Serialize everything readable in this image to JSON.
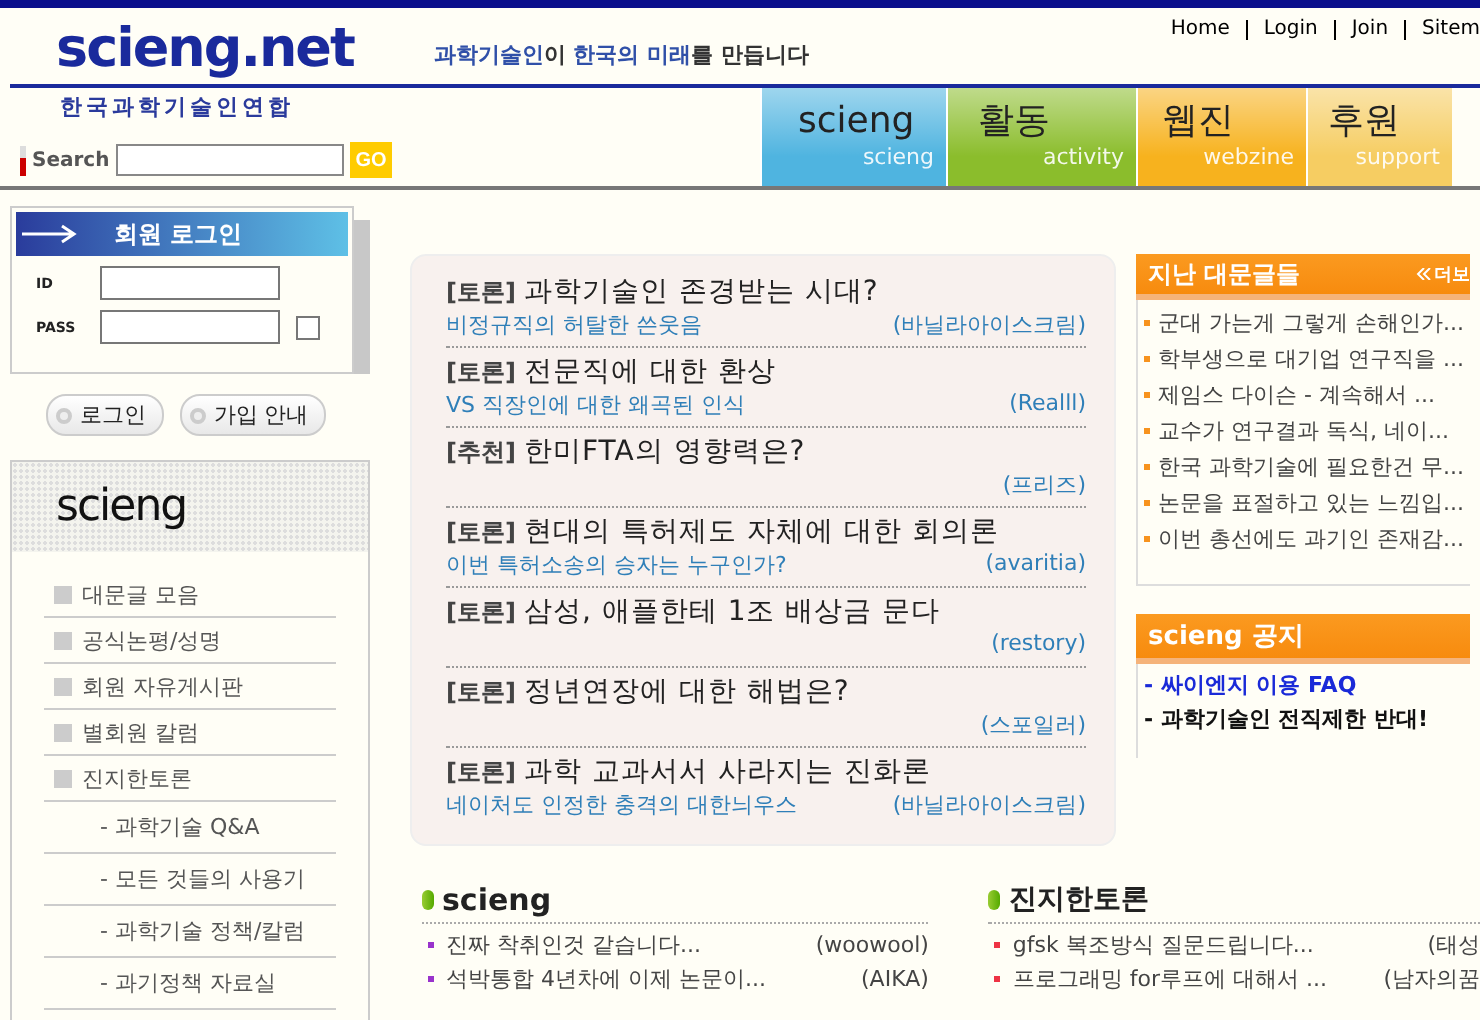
{
  "header": {
    "logo": "scieng.net",
    "tagline": [
      {
        "text": "과학기술인",
        "highlight": true
      },
      {
        "text": "이 ",
        "highlight": false
      },
      {
        "text": "한국의 미래",
        "highlight": true
      },
      {
        "text": "를 만듭니다",
        "highlight": false
      }
    ],
    "links": [
      "Home",
      "Login",
      "Join",
      "Sitem"
    ],
    "subtitle": "한국과학기술인연합"
  },
  "search": {
    "label": "Search",
    "button": "GO"
  },
  "tabs": [
    {
      "label": "scieng",
      "sublabel": "scieng",
      "color": "#4fb4e0"
    },
    {
      "label": "활동",
      "sublabel": "activity",
      "color": "#8bbd2c"
    },
    {
      "label": "웹진",
      "sublabel": "webzine",
      "color": "#f7b21e"
    },
    {
      "label": "후원",
      "sublabel": "support",
      "color": "#f6cd62"
    }
  ],
  "login": {
    "title": "회원 로그인",
    "id_label": "ID",
    "pass_label": "PASS",
    "remember": false,
    "buttons": [
      "로그인",
      "가입 안내"
    ]
  },
  "sidebar": {
    "title": "scieng",
    "items": [
      {
        "label": "대문글 모음"
      },
      {
        "label": "공식논평/성명"
      },
      {
        "label": "회원 자유게시판"
      },
      {
        "label": "별회원 칼럼"
      },
      {
        "label": "진지한토론",
        "children": [
          {
            "label": "- 과학기술 Q&A"
          },
          {
            "label": "- 모든 것들의 사용기"
          },
          {
            "label": "- 과학기술 정책/칼럼"
          },
          {
            "label": "- 과기정책 자료실"
          }
        ]
      }
    ]
  },
  "featured": [
    {
      "tag": "[토론]",
      "title": "과학기술인 존경받는 시대?",
      "subtitle": "비정규직의 허탈한 쓴웃음",
      "author": "(바닐라아이스크림)"
    },
    {
      "tag": "[토론]",
      "title": "전문직에 대한 환상",
      "subtitle": "VS 직장인에 대한 왜곡된 인식",
      "author": "(Realll)"
    },
    {
      "tag": "[추천]",
      "title": "한미FTA의 영향력은?",
      "author": "(프리즈)"
    },
    {
      "tag": "[토론]",
      "title": "현대의 특허제도 자체에 대한 회의론",
      "subtitle": "이번 특허소송의 승자는 누구인가?",
      "author": "(avaritia)"
    },
    {
      "tag": "[토론]",
      "title": "삼성, 애플한테 1조 배상금 문다",
      "author": "(restory)"
    },
    {
      "tag": "[토론]",
      "title": "정년연장에 대한 해법은?",
      "author": "(스포일러)"
    },
    {
      "tag": "[토론]",
      "title": "과학 교과서서 사라지는 진화론",
      "subtitle": "네이처도 인정한 충격의 대한늬우스",
      "author": "(바닐라아이스크림)"
    }
  ],
  "past_posts": {
    "title": "지난 대문글들",
    "more": "더보",
    "items": [
      "군대 가는게 그렇게 손해인가...",
      "학부생으로 대기업 연구직을 ...",
      "제임스 다이슨 - 계속해서 ...",
      "교수가 연구결과 독식, 네이...",
      "한국 과학기술에 필요한건 무...",
      "논문을 표절하고 있는 느낌입...",
      "이번 총선에도 과기인 존재감..."
    ]
  },
  "notice": {
    "title": "scieng 공지",
    "items": [
      {
        "text": "- 싸이엔지 이용 FAQ",
        "kind": "link"
      },
      {
        "text": "- 과학기술인 전직제한 반대!",
        "kind": "plain"
      }
    ]
  },
  "boards": [
    {
      "title": "scieng",
      "color": "#9933cc",
      "posts": [
        {
          "title": "진짜 착취인것 같습니다...",
          "author": "(woowool)"
        },
        {
          "title": "석박통합 4년차에 이제 논문이...",
          "author": "(AIKA)"
        }
      ]
    },
    {
      "title": "진지한토론",
      "color": "#ee3344",
      "posts": [
        {
          "title": "gfsk 복조방식 질문드립니다...",
          "author": "(태성"
        },
        {
          "title": "프로그래밍 for루프에 대해서 ...",
          "author": "(남자의꿈"
        }
      ]
    }
  ]
}
